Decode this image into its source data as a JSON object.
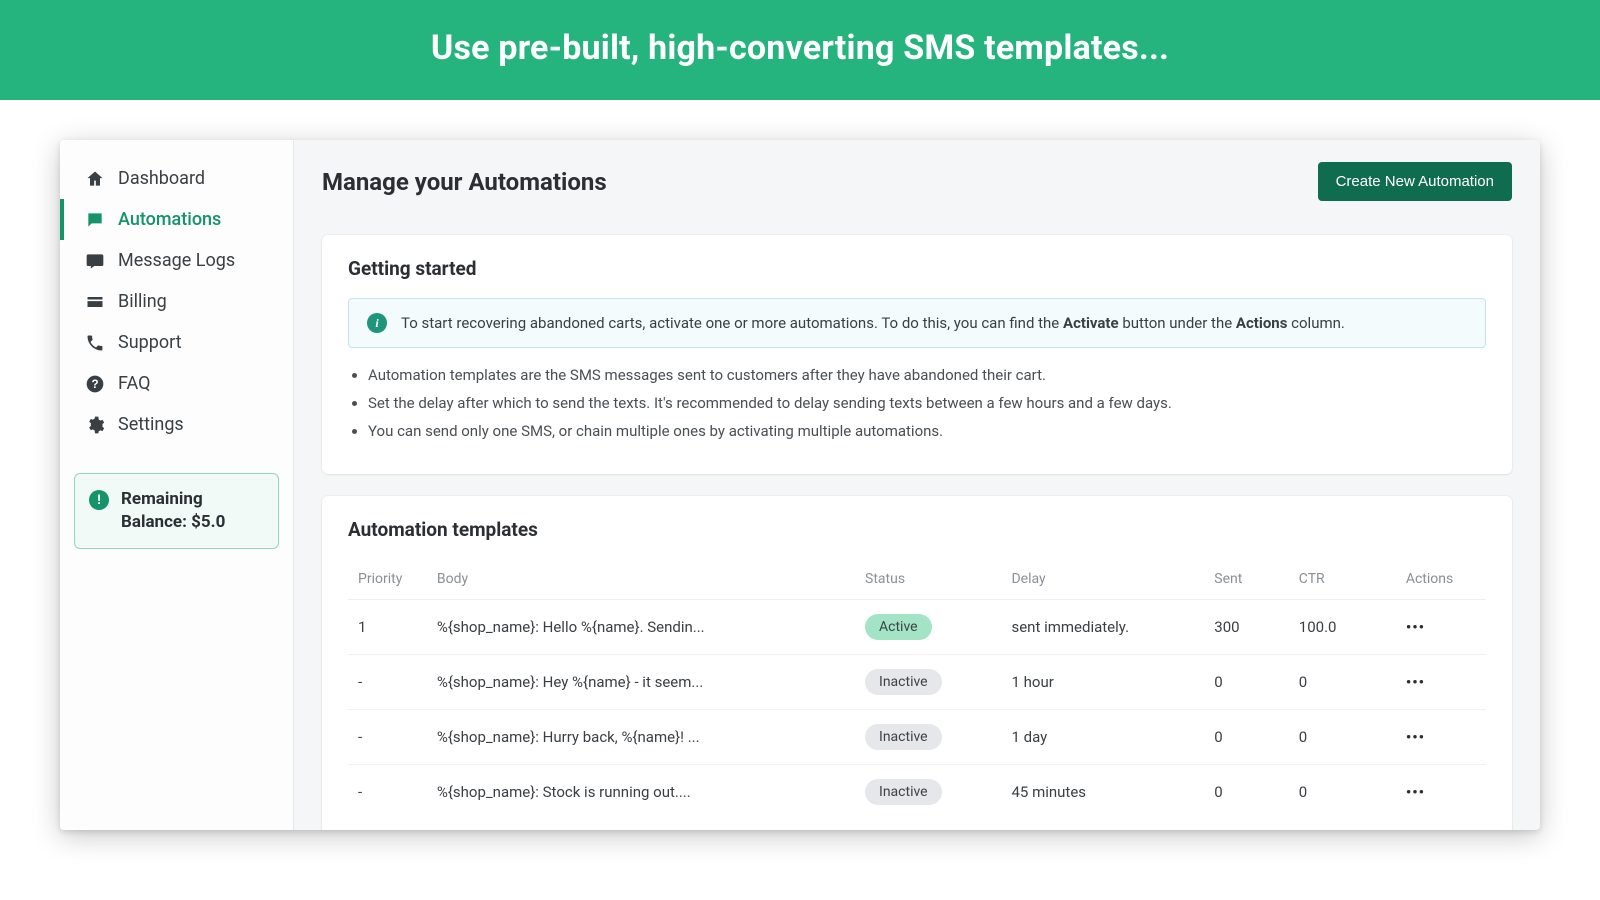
{
  "banner": {
    "headline": "Use pre-built, high-converting SMS templates..."
  },
  "sidebar": {
    "items": [
      {
        "label": "Dashboard",
        "icon": "home-icon",
        "active": false
      },
      {
        "label": "Automations",
        "icon": "chat-icon",
        "active": true
      },
      {
        "label": "Message Logs",
        "icon": "sms-icon",
        "active": false
      },
      {
        "label": "Billing",
        "icon": "card-icon",
        "active": false
      },
      {
        "label": "Support",
        "icon": "phone-icon",
        "active": false
      },
      {
        "label": "FAQ",
        "icon": "help-icon",
        "active": false
      },
      {
        "label": "Settings",
        "icon": "gear-icon",
        "active": false
      }
    ],
    "balance": {
      "label": "Remaining Balance: $5.0"
    }
  },
  "page": {
    "title": "Manage your Automations",
    "create_button": "Create New Automation"
  },
  "getting_started": {
    "title": "Getting started",
    "info_prefix": "To start recovering abandoned carts, activate one or more automations. To do this, you can find the ",
    "info_bold1": "Activate",
    "info_mid": " button under the ",
    "info_bold2": "Actions",
    "info_suffix": " column.",
    "bullets": [
      "Automation templates are the SMS messages sent to customers after they have abandoned their cart.",
      "Set the delay after which to send the texts. It's recommended to delay sending texts between a few hours and a few days.",
      "You can send only one SMS, or chain multiple ones by activating multiple automations."
    ]
  },
  "templates": {
    "title": "Automation templates",
    "columns": {
      "priority": "Priority",
      "body": "Body",
      "status": "Status",
      "delay": "Delay",
      "sent": "Sent",
      "ctr": "CTR",
      "actions": "Actions"
    },
    "rows": [
      {
        "priority": "1",
        "body": "%{shop_name}: Hello %{name}. Sendin...",
        "status": "Active",
        "delay": "sent immediately.",
        "sent": "300",
        "ctr": "100.0"
      },
      {
        "priority": "-",
        "body": "%{shop_name}: Hey %{name} - it seem...",
        "status": "Inactive",
        "delay": "1 hour",
        "sent": "0",
        "ctr": "0"
      },
      {
        "priority": "-",
        "body": "%{shop_name}: Hurry back, %{name}! ...",
        "status": "Inactive",
        "delay": "1 day",
        "sent": "0",
        "ctr": "0"
      },
      {
        "priority": "-",
        "body": "%{shop_name}: Stock is running out....",
        "status": "Inactive",
        "delay": "45 minutes",
        "sent": "0",
        "ctr": "0"
      }
    ],
    "actions_glyph": "•••"
  }
}
